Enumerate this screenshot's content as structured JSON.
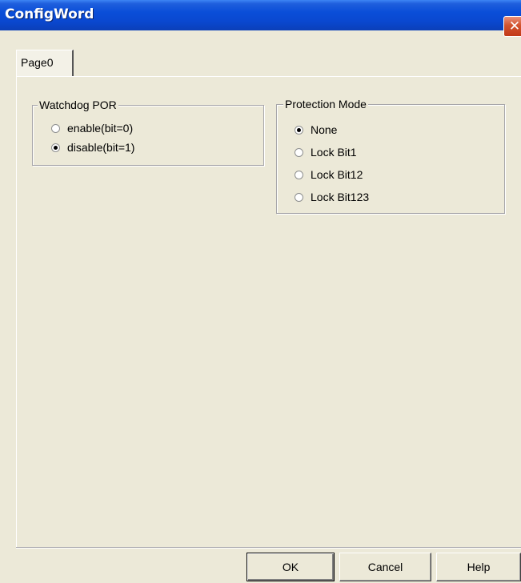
{
  "window": {
    "title": "ConfigWord",
    "close_glyph": "✕"
  },
  "tabs": [
    {
      "label": "Page0",
      "selected": true
    }
  ],
  "groups": {
    "watchdog": {
      "legend": "Watchdog POR",
      "options": [
        {
          "label": "enable(bit=0)",
          "checked": false
        },
        {
          "label": "disable(bit=1)",
          "checked": true
        }
      ]
    },
    "protection": {
      "legend": "Protection Mode",
      "options": [
        {
          "label": "None",
          "checked": true
        },
        {
          "label": "Lock Bit1",
          "checked": false
        },
        {
          "label": "Lock Bit12",
          "checked": false
        },
        {
          "label": "Lock Bit123",
          "checked": false
        }
      ]
    }
  },
  "buttons": {
    "ok": "OK",
    "cancel": "Cancel",
    "help": "Help"
  },
  "colors": {
    "title_bar": "#0a4ed8",
    "dialog_bg": "#ece9d8",
    "close_button": "#d2532e"
  }
}
